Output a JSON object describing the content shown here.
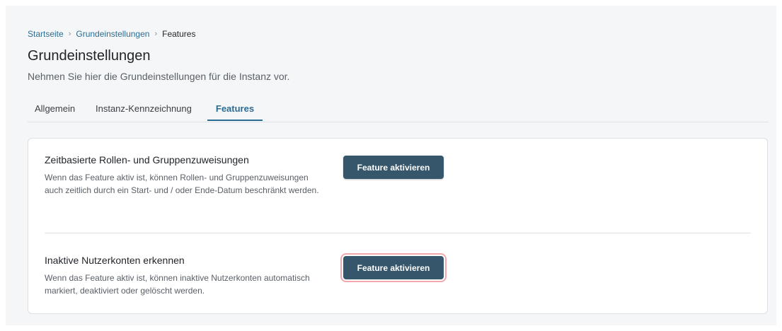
{
  "breadcrumb": {
    "items": [
      "Startseite",
      "Grundeinstellungen"
    ],
    "current": "Features",
    "separator": "›"
  },
  "header": {
    "title": "Grundeinstellungen",
    "subtitle": "Nehmen Sie hier die Grundeinstellungen für die Instanz vor."
  },
  "tabs": [
    {
      "label": "Allgemein",
      "active": false
    },
    {
      "label": "Instanz-Kennzeichnung",
      "active": false
    },
    {
      "label": "Features",
      "active": true
    }
  ],
  "features": [
    {
      "title": "Zeitbasierte Rollen- und Gruppenzuweisungen",
      "description": "Wenn das Feature aktiv ist, können Rollen- und Gruppenzuweisungen auch zeitlich durch ein Start- und / oder Ende-Datum beschränkt werden.",
      "button_label": "Feature aktivieren"
    },
    {
      "title": "Inaktive Nutzerkonten erkennen",
      "description": "Wenn das Feature aktiv ist, können inaktive Nutzerkonten automatisch markiert, deaktiviert oder gelöscht werden.",
      "button_label": "Feature aktivieren"
    }
  ],
  "colors": {
    "accent": "#2a6d94",
    "button": "#36566c",
    "focus_ring": "#f0a8ad"
  }
}
